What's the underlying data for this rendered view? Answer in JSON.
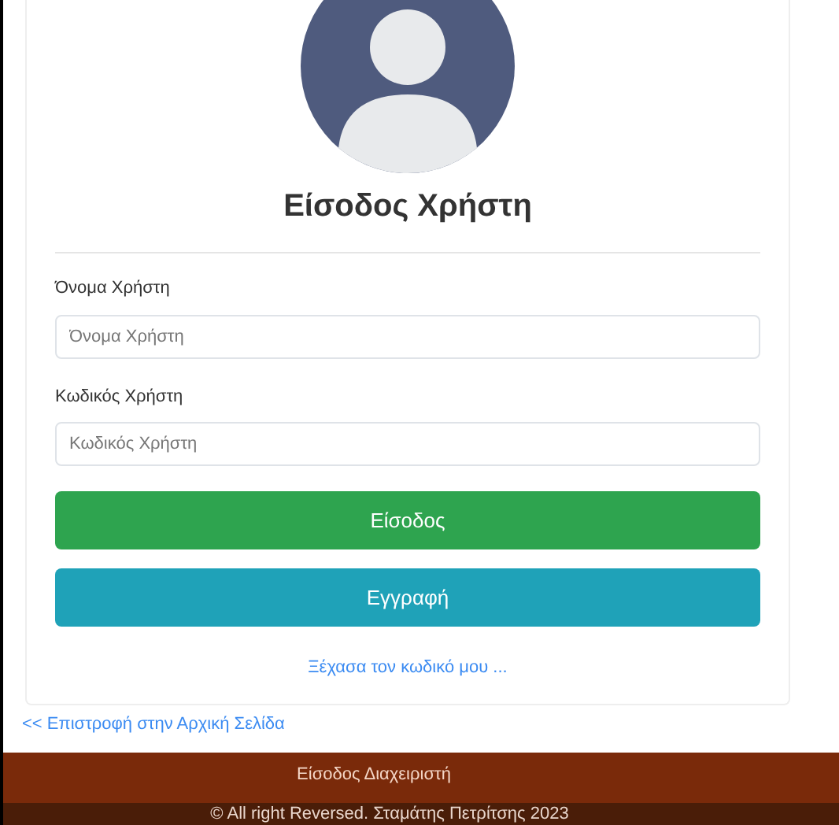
{
  "login": {
    "title": "Είσοδος Χρήστη",
    "fields": [
      {
        "label": "Όνομα Χρήστη",
        "placeholder": "Όνομα Χρήστη"
      },
      {
        "label": "Κωδικός Χρήστη",
        "placeholder": "Κωδικός Χρήστη"
      }
    ],
    "buttons": [
      {
        "label": "Είσοδος",
        "kind": "primary"
      },
      {
        "label": "Εγγραφή",
        "kind": "secondary"
      }
    ],
    "forgot_link": "Ξέχασα τον κωδικό μου ..."
  },
  "back_link": "<< Επιστροφή στην Αρχική Σελίδα",
  "footer": {
    "admin_link": "Είσοδος Διαχειριστή",
    "copyright": "© All right Reversed. Σταμάτης Πετρίτσης 2023"
  }
}
